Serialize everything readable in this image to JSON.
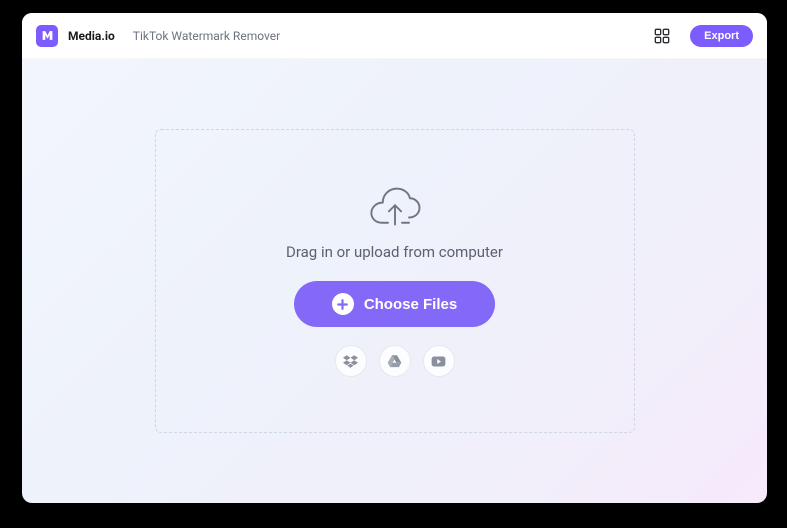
{
  "header": {
    "brand": "Media.io",
    "tool_name": "TikTok Watermark Remover",
    "export_label": "Export"
  },
  "dropzone": {
    "prompt": "Drag in or upload from computer",
    "choose_label": "Choose Files"
  },
  "icons": {
    "logo": "media-io-logo",
    "apps": "apps-grid-icon",
    "cloud_upload": "cloud-upload-icon",
    "plus": "plus-icon",
    "dropbox": "dropbox-icon",
    "gdrive": "google-drive-icon",
    "youtube": "youtube-icon"
  },
  "colors": {
    "accent": "#7c5cff",
    "button": "#8468f8",
    "text_muted": "#6b7280",
    "text_body": "#5a6270",
    "border_dashed": "#cfd6e3"
  }
}
